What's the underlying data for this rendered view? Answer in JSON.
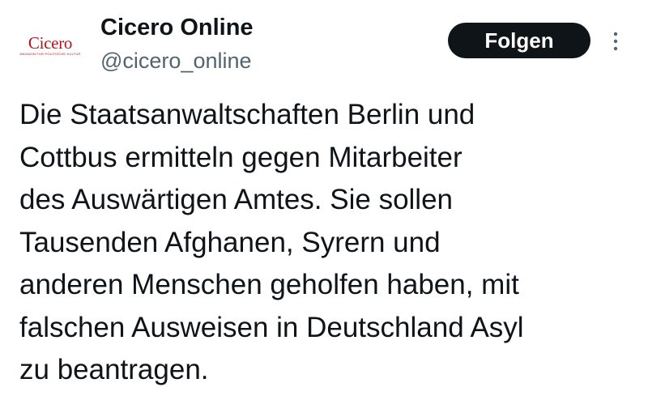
{
  "author": {
    "avatar": {
      "logo_text": "Cicero",
      "tagline": "MAGAZIN FÜR POLITISCHE KULTUR"
    },
    "display_name": "Cicero Online",
    "handle": "@cicero_online"
  },
  "actions": {
    "follow_label": "Folgen",
    "more_icon": "more-vertical-icon"
  },
  "tweet": {
    "text": "Die Staatsanwaltschaften Berlin und\nCottbus ermitteln gegen Mitarbeiter\ndes Auswärtigen Amtes. Sie sollen\nTausenden Afghanen, Syrern und\nanderen  Menschen geholfen haben, mit\nfalschen Ausweisen in Deutschland Asyl\nzu  beantragen."
  },
  "colors": {
    "text_primary": "#0f1419",
    "text_secondary": "#536471",
    "button_bg": "#0f1419",
    "button_text": "#ffffff",
    "brand_red": "#b4141c"
  }
}
